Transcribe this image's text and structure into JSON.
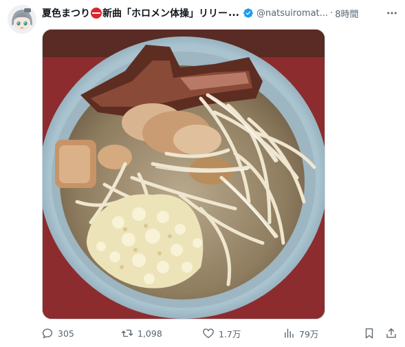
{
  "tweet": {
    "display_name": "夏色まつり",
    "name_after_emoji": "新曲「ホロメン体操」リリー",
    "name_ellipsis": "...",
    "handle": "@natsuiromat...",
    "separator": "·",
    "time": "8時間",
    "verified": true,
    "more_icon": "more-horizontal-icon",
    "name_emoji_icon": "no-entry-emoji-icon",
    "media_description_icon": "ramen-photo"
  },
  "actions": {
    "reply_count": "305",
    "retweet_count": "1,098",
    "like_count": "1.7万",
    "view_count": "79万"
  },
  "colors": {
    "verified_blue": "#1d9bf0",
    "secondary_text": "#536471",
    "primary_text": "#0f1419"
  }
}
